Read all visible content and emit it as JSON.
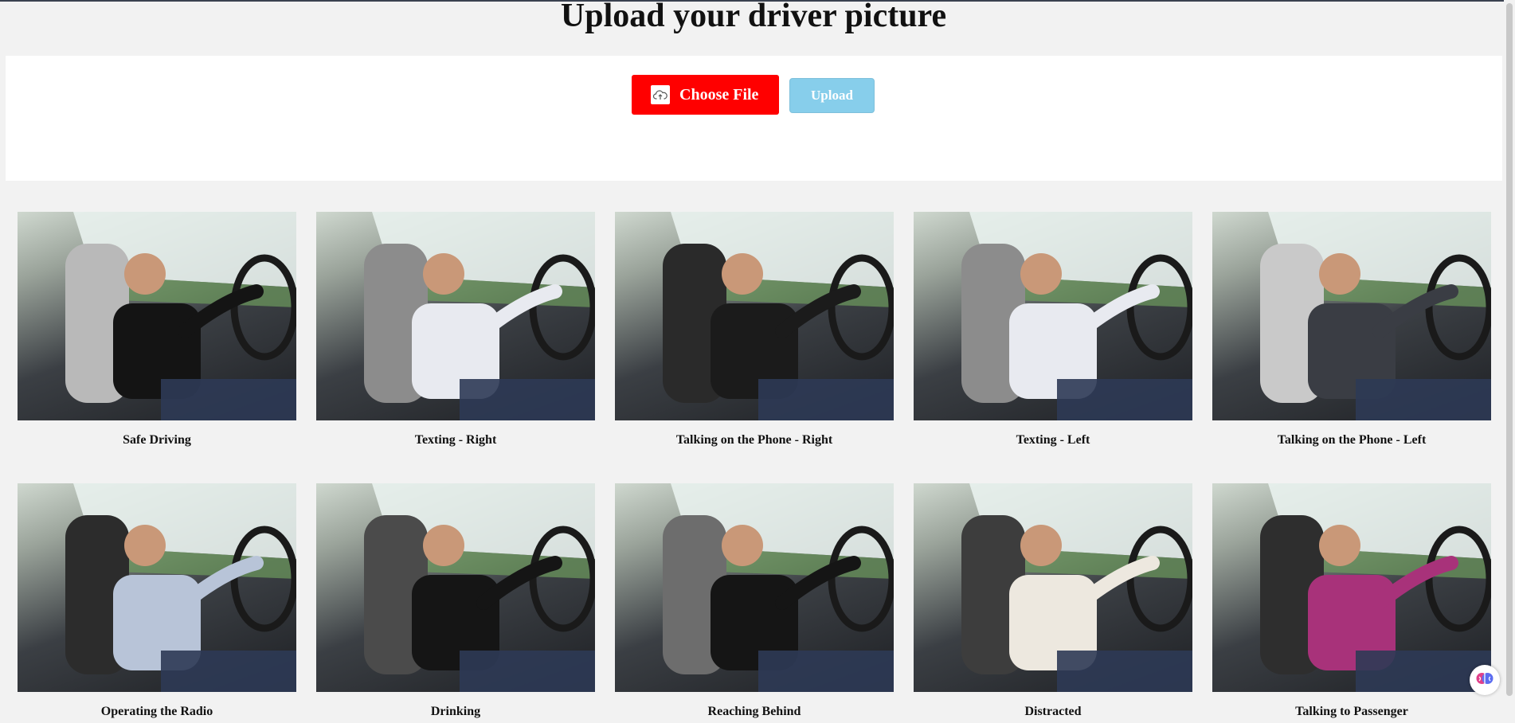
{
  "page": {
    "title": "Upload your driver picture"
  },
  "upload": {
    "choose_label": "Choose File",
    "choose_icon": "cloud-upload-icon",
    "upload_label": "Upload",
    "choose_color": "#ff0000",
    "upload_color": "#87ceeb"
  },
  "categories": [
    {
      "label": "Safe Driving",
      "shirt": "#141414",
      "seat": "#b9b9b9"
    },
    {
      "label": "Texting - Right",
      "shirt": "#e8eaf0",
      "seat": "#8c8c8c"
    },
    {
      "label": "Talking on the Phone - Right",
      "shirt": "#1b1b1b",
      "seat": "#2a2a2a"
    },
    {
      "label": "Texting - Left",
      "shirt": "#e8eaf0",
      "seat": "#8c8c8c"
    },
    {
      "label": "Talking on the Phone - Left",
      "shirt": "#3a3d44",
      "seat": "#c9c9c9"
    },
    {
      "label": "Operating the Radio",
      "shirt": "#b8c4d8",
      "seat": "#2c2c2c"
    },
    {
      "label": "Drinking",
      "shirt": "#151515",
      "seat": "#4b4b4b"
    },
    {
      "label": "Reaching Behind",
      "shirt": "#151515",
      "seat": "#6d6d6d"
    },
    {
      "label": "Distracted",
      "shirt": "#ede8df",
      "seat": "#3d3d3d"
    },
    {
      "label": "Talking to Passenger",
      "shirt": "#a8327a",
      "seat": "#2e2e2e"
    }
  ],
  "assistant_icon": "brain-icon"
}
